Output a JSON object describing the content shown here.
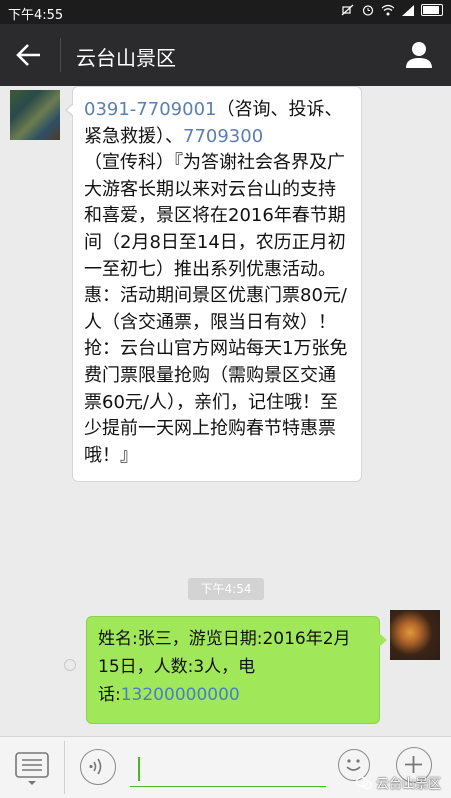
{
  "status_bar": {
    "time": "下午4:55"
  },
  "header": {
    "title": "云台山景区"
  },
  "messages": {
    "incoming": {
      "phone1": "0391-7709001",
      "mid1": "（咨询、投诉、紧急救援）、",
      "phone2": "7709300",
      "mid2": "（宣传科）",
      "body": "『为答谢社会各界及广大游客长期以来对云台山的支持和喜爱，景区将在2016年春节期间（2月8日至14日，农历正月初一至初七）推出系列优惠活动。惠：活动期间景区优惠门票80元/人（含交通票，限当日有效）！抢：云台山官方网站每天1万张免费门票限量抢购（需购景区交通票60元/人），亲们，记住哦！至少提前一天网上抢购春节特惠票哦！』"
    },
    "timestamp": "下午4:54",
    "outgoing": {
      "text": "姓名:张三，游览日期:2016年2月15日，人数:3人，电话:",
      "phone": "13200000000"
    }
  },
  "input_bar": {
    "placeholder": ""
  },
  "watermark": {
    "text": "云台山景区"
  },
  "colors": {
    "bubble_out": "#a0e75a",
    "link": "#5b7fb0",
    "accent_green": "#45c01a",
    "title_bg": "#2b2b2d"
  }
}
